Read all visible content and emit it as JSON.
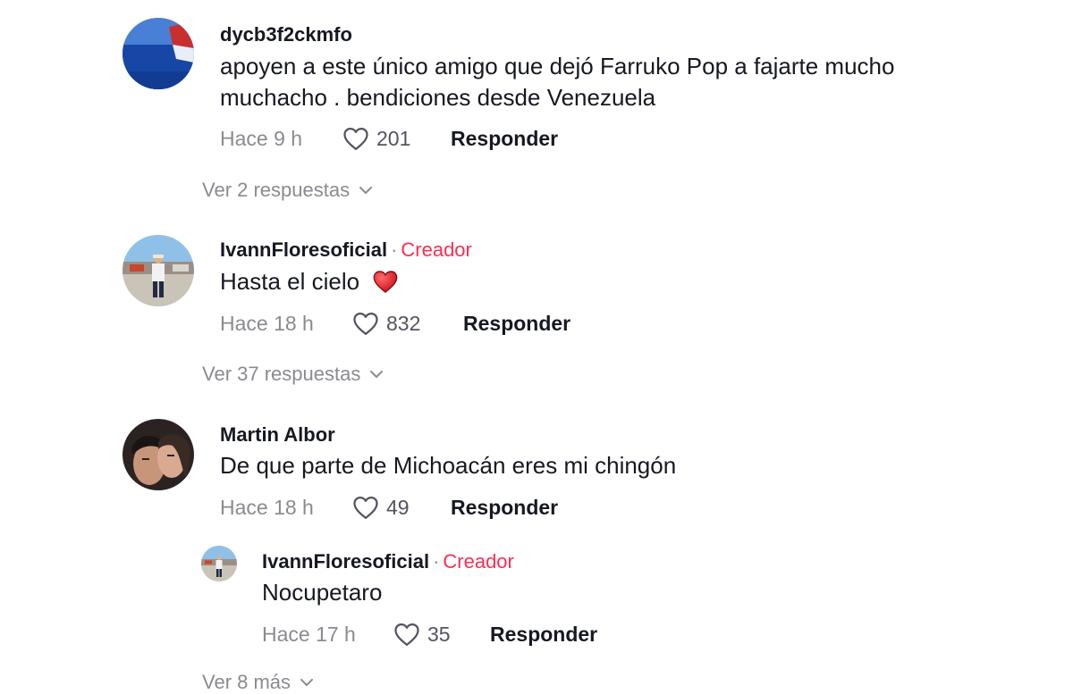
{
  "comments": [
    {
      "username": "dycb3f2ckmfo",
      "text_line1": "apoyen a este único amigo que dejó Farruko Pop a fajarte mucho",
      "text_line2": "muchacho . bendiciones desde Venezuela",
      "time": "Hace 9 h",
      "likes": "201",
      "reply_label": "Responder",
      "view_replies": "Ver 2 respuestas"
    },
    {
      "username": "IvannFloresoficial",
      "creator_dot": "·",
      "creator_tag": "Creador",
      "text": "Hasta el cielo",
      "emoji": "red-heart-emoji",
      "time": "Hace 18 h",
      "likes": "832",
      "reply_label": "Responder",
      "view_replies": "Ver 37 respuestas"
    },
    {
      "username": "Martin Albor",
      "text": "De que parte de Michoacán eres mi chingón",
      "time": "Hace 18 h",
      "likes": "49",
      "reply_label": "Responder",
      "replies": [
        {
          "username": "IvannFloresoficial",
          "creator_dot": "·",
          "creator_tag": "Creador",
          "text": "Nocupetaro",
          "time": "Hace 17 h",
          "likes": "35",
          "reply_label": "Responder"
        }
      ],
      "view_more": "Ver 8 más"
    }
  ],
  "colors": {
    "accent": "#fe2c55",
    "text": "#161823",
    "muted": "#8a8b91"
  }
}
